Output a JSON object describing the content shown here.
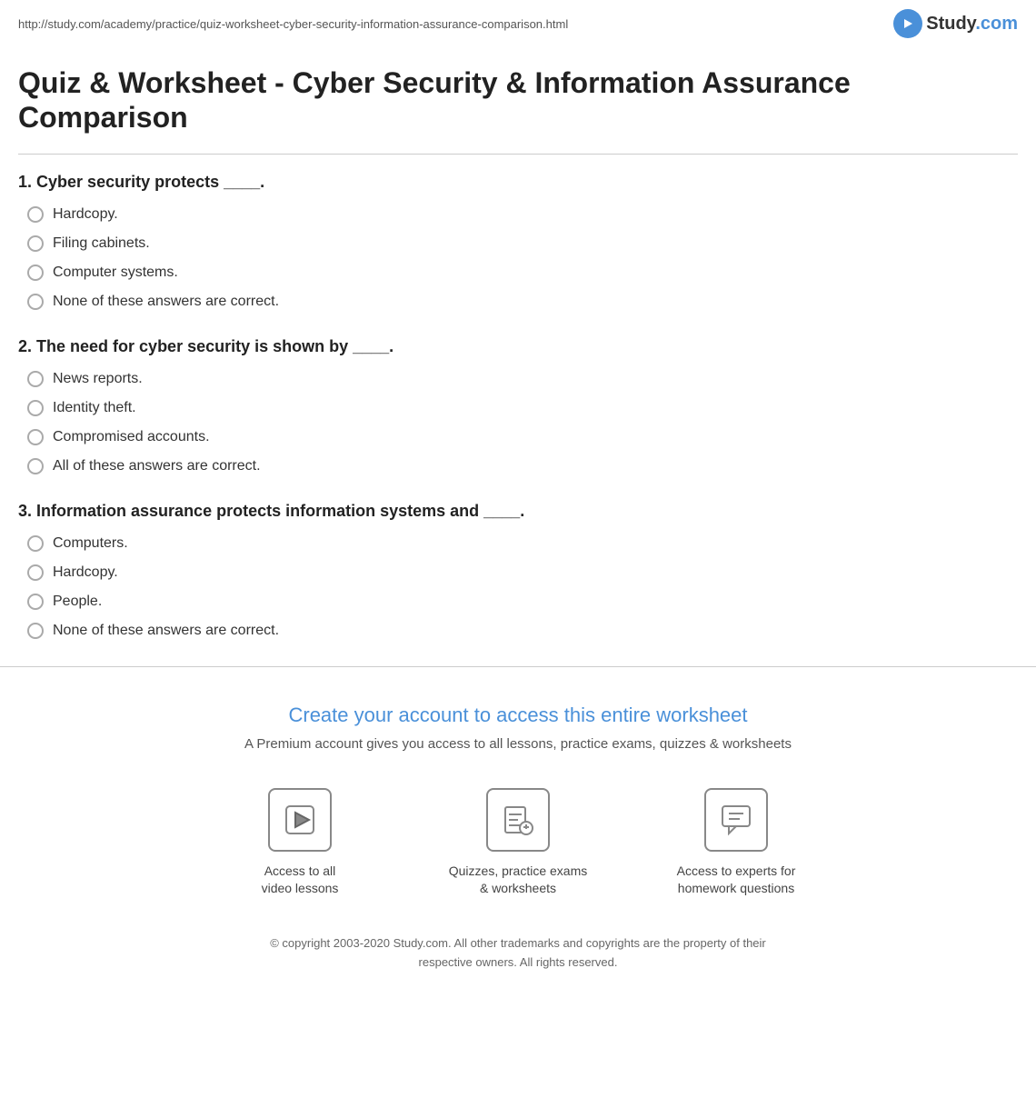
{
  "url": "http://study.com/academy/practice/quiz-worksheet-cyber-security-information-assurance-comparison.html",
  "logo": {
    "text": "Study.com",
    "brand_color": "#4a90d9"
  },
  "page_title": "Quiz & Worksheet - Cyber Security & Information Assurance Comparison",
  "questions": [
    {
      "number": "1.",
      "text": "Cyber security protects ____.",
      "options": [
        "Hardcopy.",
        "Filing cabinets.",
        "Computer systems.",
        "None of these answers are correct."
      ]
    },
    {
      "number": "2.",
      "text": "The need for cyber security is shown by ____.",
      "options": [
        "News reports.",
        "Identity theft.",
        "Compromised accounts.",
        "All of these answers are correct."
      ]
    },
    {
      "number": "3.",
      "text": "Information assurance protects information systems and ____.",
      "options": [
        "Computers.",
        "Hardcopy.",
        "People.",
        "None of these answers are correct."
      ]
    }
  ],
  "footer": {
    "cta_title": "Create your account to access this entire worksheet",
    "cta_subtitle": "A Premium account gives you access to all lessons, practice exams, quizzes & worksheets",
    "features": [
      {
        "icon": "play",
        "label": "Access to all\nvideo lessons"
      },
      {
        "icon": "quiz",
        "label": "Quizzes, practice exams\n& worksheets"
      },
      {
        "icon": "chat",
        "label": "Access to experts for\nhomework questions"
      }
    ],
    "copyright": "© copyright 2003-2020 Study.com. All other trademarks and copyrights are the property of their respective owners. All rights reserved."
  }
}
